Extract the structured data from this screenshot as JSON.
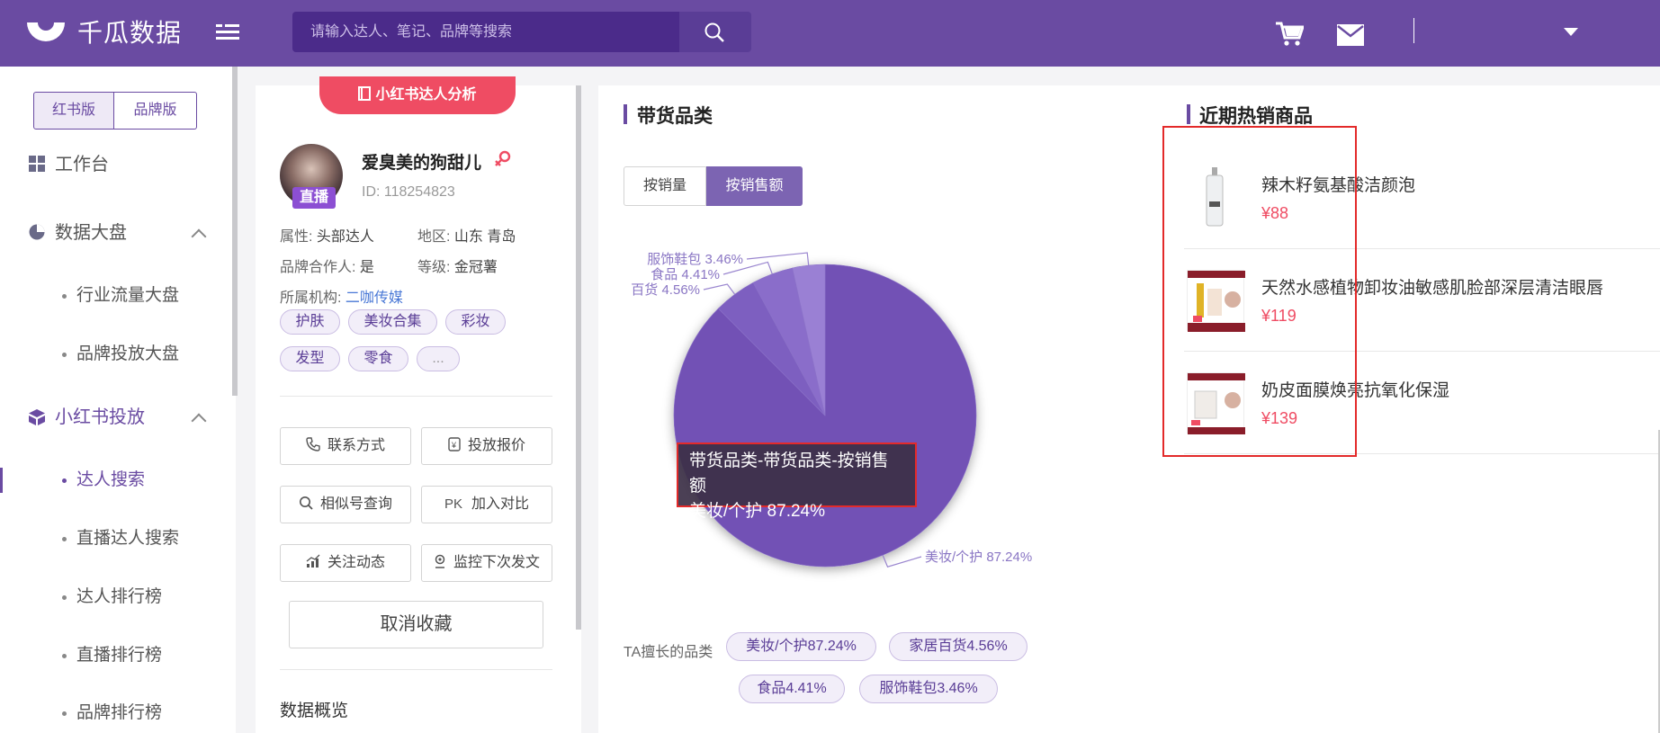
{
  "header": {
    "brand": "千瓜数据",
    "search_placeholder": "请输入达人、笔记、品牌等搜索"
  },
  "sidebar": {
    "version_tabs": [
      "红书版",
      "品牌版"
    ],
    "workbench": "工作台",
    "data_board": "数据大盘",
    "data_board_items": [
      "行业流量大盘",
      "品牌投放大盘"
    ],
    "xhs": "小红书投放",
    "xhs_items": [
      "达人搜索",
      "直播达人搜索",
      "达人排行榜",
      "直播排行榜",
      "品牌排行榜"
    ]
  },
  "profile": {
    "banner": "小红书达人分析",
    "live_badge": "直播",
    "name": "爱臭美的狗甜儿",
    "id": "ID:  118254823",
    "attr_label": "属性: ",
    "attr": "头部达人",
    "region_label": "地区: ",
    "region": "山东 青岛",
    "partner_label": "品牌合作人: ",
    "partner": "是",
    "level_label": "等级: ",
    "level": "金冠薯",
    "agency_label": "所属机构: ",
    "agency": "二咖传媒",
    "tags": [
      "护肤",
      "美妆合集",
      "彩妆",
      "发型",
      "零食",
      "..."
    ],
    "actions": [
      "联系方式",
      "投放报价",
      "相似号查询",
      "加入对比",
      "关注动态",
      "监控下次发文"
    ],
    "pk": "PK",
    "unfavorite": "取消收藏",
    "overview": "数据概览"
  },
  "category": {
    "title": "带货品类",
    "modes": [
      "按销量",
      "按销售额"
    ],
    "tooltip_title": "带货品类-带货品类-按销售额",
    "tooltip_value": "美妆/个护 87.24%",
    "ta_label": "TA擅长的品类",
    "ta_tags": [
      "美妆/个护87.24%",
      "家居百货4.56%",
      "食品4.41%",
      "服饰鞋包3.46%"
    ]
  },
  "chart_data": {
    "type": "pie",
    "labels": [
      "美妆/个护",
      "百货",
      "食品",
      "服饰鞋包"
    ],
    "values": [
      87.24,
      4.56,
      4.41,
      3.46
    ],
    "label_texts": [
      "美妆/个护 87.24%",
      "百货 4.56%",
      "食品 4.41%",
      "服饰鞋包 3.46%"
    ],
    "colors": [
      "#7251b5",
      "#7d5fc0",
      "#8a6dca",
      "#9a80d4"
    ]
  },
  "hot": {
    "title": "近期热销商品",
    "products": [
      {
        "name": "辣木籽氨基酸洁颜泡",
        "price": "¥88"
      },
      {
        "name": "天然水感植物卸妆油敏感肌脸部深层清洁眼唇",
        "price": "¥119"
      },
      {
        "name": "奶皮面膜焕亮抗氧化保湿",
        "price": "¥139"
      }
    ]
  },
  "colors": {
    "header": "#6a4ba2",
    "accent": "#ef4c63",
    "pie": "#7251b5"
  }
}
